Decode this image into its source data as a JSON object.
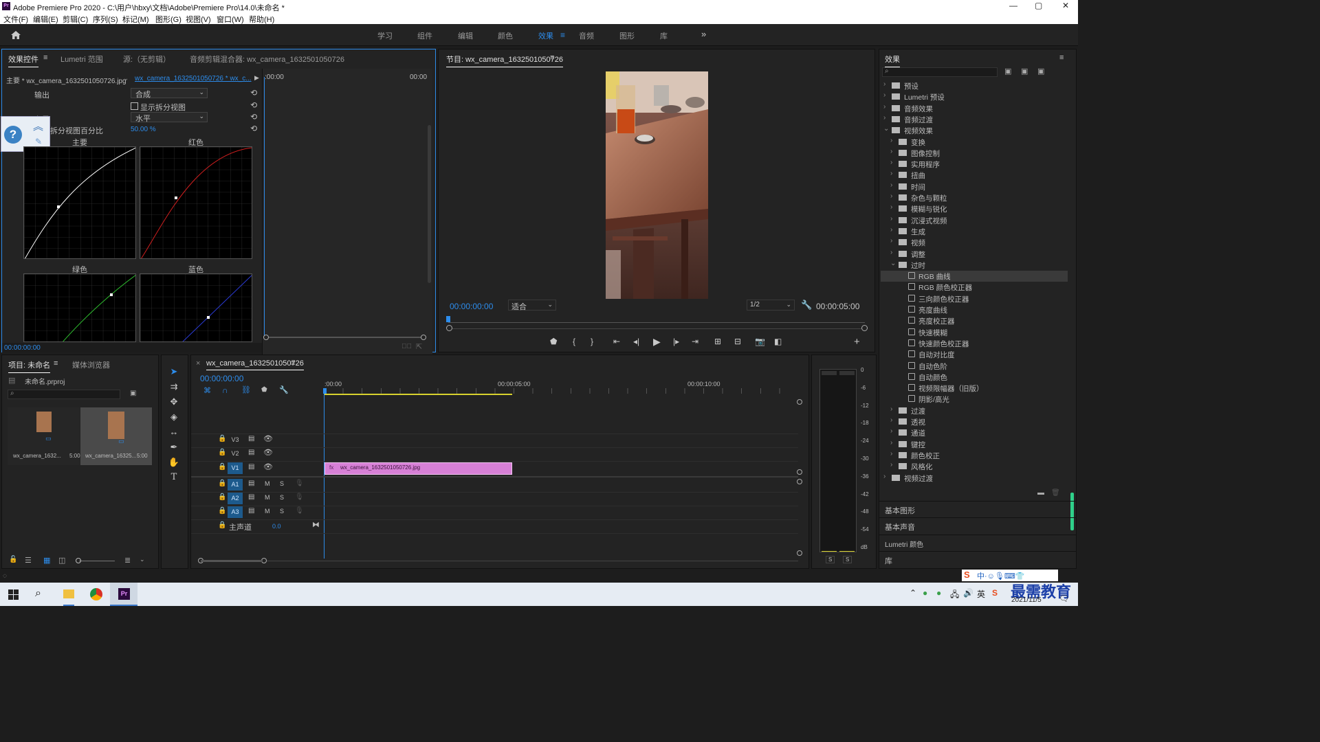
{
  "window": {
    "app_icon": "Pr",
    "title": "Adobe Premiere Pro 2020 - C:\\用户\\hbxy\\文档\\Adobe\\Premiere Pro\\14.0\\未命名 *",
    "controls": [
      "—",
      "▢",
      "✕"
    ]
  },
  "menu": [
    "文件(F)",
    "编辑(E)",
    "剪辑(C)",
    "序列(S)",
    "标记(M)",
    "图形(G)",
    "视图(V)",
    "窗口(W)",
    "帮助(H)"
  ],
  "workspaces": {
    "items": [
      "学习",
      "组件",
      "编辑",
      "颜色",
      "效果",
      "音频",
      "图形",
      "库"
    ],
    "active": "效果",
    "more": "»"
  },
  "effect_controls": {
    "tabs": [
      "效果控件",
      "Lumetri 范围",
      "源:（无剪辑）",
      "音频剪辑混合器: wx_camera_1632501050726"
    ],
    "clip_master": "主要 * wx_camera_1632501050726.jpg",
    "clip_seq": "wx_camera_1632501050726 * wx_c...",
    "mini_time_start": ":00:00",
    "mini_time_end": "00:00",
    "rows": {
      "output_label": "输出",
      "output_value": "合成",
      "split_label": "显示拆分视图",
      "layout_label": "布局",
      "layout_value": "水平",
      "split_pct_label": "拆分视图百分比",
      "split_pct_value": "50.00 %"
    },
    "graphs": {
      "master": "主要",
      "red": "红色",
      "green": "绿色",
      "blue": "蓝色"
    },
    "timecode": "00:00:00:00"
  },
  "program_monitor": {
    "title": "节目: wx_camera_1632501050726",
    "timecode": "00:00:00:00",
    "fit": "适合",
    "resolution": "1/2",
    "duration": "00:00:05:00"
  },
  "project": {
    "tabs": [
      "项目: 未命名",
      "媒体浏览器"
    ],
    "file": "未命名.prproj",
    "items": [
      {
        "name": "wx_camera_1632...",
        "duration": "5:00"
      },
      {
        "name": "wx_camera_16325...",
        "duration": "5:00"
      }
    ]
  },
  "timeline": {
    "tab": "wx_camera_1632501050726",
    "timecode": "00:00:00:00",
    "ruler": [
      ":00:00",
      "00:00:05:00",
      "00:00:10:00"
    ],
    "video_tracks": [
      "V3",
      "V2",
      "V1"
    ],
    "audio_tracks": [
      "A1",
      "A2",
      "A3"
    ],
    "master_label": "主声道",
    "master_value": "0.0",
    "clip_name": "wx_camera_1632501050726.jpg",
    "mute": "M",
    "solo": "S"
  },
  "meter": {
    "scale": [
      "0",
      "-6",
      "-12",
      "-18",
      "-24",
      "-30",
      "-36",
      "-42",
      "-48",
      "-54",
      "dB"
    ],
    "solo": [
      "S",
      "S"
    ]
  },
  "effects_panel": {
    "title": "效果",
    "tree": [
      {
        "label": "预设",
        "level": 0,
        "type": "folder",
        "open": false
      },
      {
        "label": "Lumetri 预设",
        "level": 0,
        "type": "folder",
        "open": false
      },
      {
        "label": "音频效果",
        "level": 0,
        "type": "folder",
        "open": false
      },
      {
        "label": "音频过渡",
        "level": 0,
        "type": "folder",
        "open": false
      },
      {
        "label": "视频效果",
        "level": 0,
        "type": "folder",
        "open": true
      },
      {
        "label": "变换",
        "level": 1,
        "type": "folder",
        "open": false
      },
      {
        "label": "图像控制",
        "level": 1,
        "type": "folder",
        "open": false
      },
      {
        "label": "实用程序",
        "level": 1,
        "type": "folder",
        "open": false
      },
      {
        "label": "扭曲",
        "level": 1,
        "type": "folder",
        "open": false
      },
      {
        "label": "时间",
        "level": 1,
        "type": "folder",
        "open": false
      },
      {
        "label": "杂色与颗粒",
        "level": 1,
        "type": "folder",
        "open": false
      },
      {
        "label": "模糊与锐化",
        "level": 1,
        "type": "folder",
        "open": false
      },
      {
        "label": "沉浸式视频",
        "level": 1,
        "type": "folder",
        "open": false
      },
      {
        "label": "生成",
        "level": 1,
        "type": "folder",
        "open": false
      },
      {
        "label": "视频",
        "level": 1,
        "type": "folder",
        "open": false
      },
      {
        "label": "调整",
        "level": 1,
        "type": "folder",
        "open": false
      },
      {
        "label": "过时",
        "level": 1,
        "type": "folder",
        "open": true
      },
      {
        "label": "RGB 曲线",
        "level": 2,
        "type": "effect",
        "selected": true
      },
      {
        "label": "RGB 颜色校正器",
        "level": 2,
        "type": "effect"
      },
      {
        "label": "三向颜色校正器",
        "level": 2,
        "type": "effect"
      },
      {
        "label": "亮度曲线",
        "level": 2,
        "type": "effect"
      },
      {
        "label": "亮度校正器",
        "level": 2,
        "type": "effect"
      },
      {
        "label": "快速模糊",
        "level": 2,
        "type": "effect"
      },
      {
        "label": "快速颜色校正器",
        "level": 2,
        "type": "effect"
      },
      {
        "label": "自动对比度",
        "level": 2,
        "type": "effect"
      },
      {
        "label": "自动色阶",
        "level": 2,
        "type": "effect"
      },
      {
        "label": "自动颜色",
        "level": 2,
        "type": "effect"
      },
      {
        "label": "视频限幅器（旧版）",
        "level": 2,
        "type": "effect"
      },
      {
        "label": "阴影/高光",
        "level": 2,
        "type": "effect"
      },
      {
        "label": "过渡",
        "level": 1,
        "type": "folder",
        "open": false
      },
      {
        "label": "透视",
        "level": 1,
        "type": "folder",
        "open": false
      },
      {
        "label": "通道",
        "level": 1,
        "type": "folder",
        "open": false
      },
      {
        "label": "键控",
        "level": 1,
        "type": "folder",
        "open": false
      },
      {
        "label": "颜色校正",
        "level": 1,
        "type": "folder",
        "open": false
      },
      {
        "label": "风格化",
        "level": 1,
        "type": "folder",
        "open": false
      },
      {
        "label": "视频过渡",
        "level": 0,
        "type": "folder",
        "open": false
      }
    ],
    "sections": [
      "基本图形",
      "基本声音",
      "Lumetri 颜色",
      "库"
    ]
  },
  "taskbar": {
    "date": "2021/11/5",
    "watermark": "最需教育"
  },
  "colors": {
    "accent": "#2d8ceb",
    "clip": "#d780d6"
  }
}
